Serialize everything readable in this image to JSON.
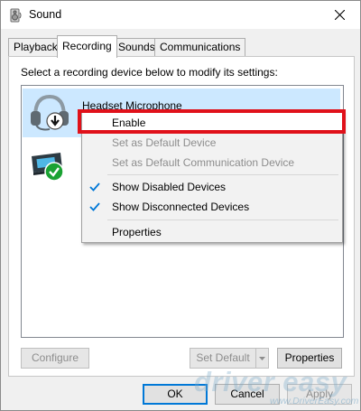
{
  "window": {
    "title": "Sound",
    "close_icon": "close-icon"
  },
  "tabs": [
    {
      "label": "Playback",
      "active": false
    },
    {
      "label": "Recording",
      "active": true
    },
    {
      "label": "Sounds",
      "active": false
    },
    {
      "label": "Communications",
      "active": false
    }
  ],
  "recording": {
    "instruction": "Select a recording device below to modify its settings:",
    "devices": [
      {
        "name": "Headset Microphone",
        "icon": "headset-icon",
        "status_icon": "down-arrow-badge-icon",
        "selected": true
      },
      {
        "name": "",
        "icon": "line-in-device-icon",
        "status_icon": "green-check-badge-icon",
        "selected": false
      }
    ]
  },
  "context_menu": {
    "items": [
      {
        "label": "Enable",
        "enabled": true,
        "checked": false,
        "highlighted": true
      },
      {
        "label": "Set as Default Device",
        "enabled": false,
        "checked": false
      },
      {
        "label": "Set as Default Communication Device",
        "enabled": false,
        "checked": false
      },
      {
        "label": "Show Disabled Devices",
        "enabled": true,
        "checked": true
      },
      {
        "label": "Show Disconnected Devices",
        "enabled": true,
        "checked": true
      },
      {
        "label": "Properties",
        "enabled": true,
        "checked": false
      }
    ],
    "highlight_color": "#e0111a"
  },
  "buttons": {
    "configure": "Configure",
    "set_default": "Set Default",
    "properties": "Properties",
    "ok": "OK",
    "cancel": "Cancel",
    "apply": "Apply"
  },
  "watermark": {
    "text": "driver easy",
    "url": "www.DriverEasy.com"
  },
  "colors": {
    "selection": "#cce8ff",
    "accent": "#0078d7",
    "check": "#0078d7",
    "ok_badge": "#1aa232"
  }
}
